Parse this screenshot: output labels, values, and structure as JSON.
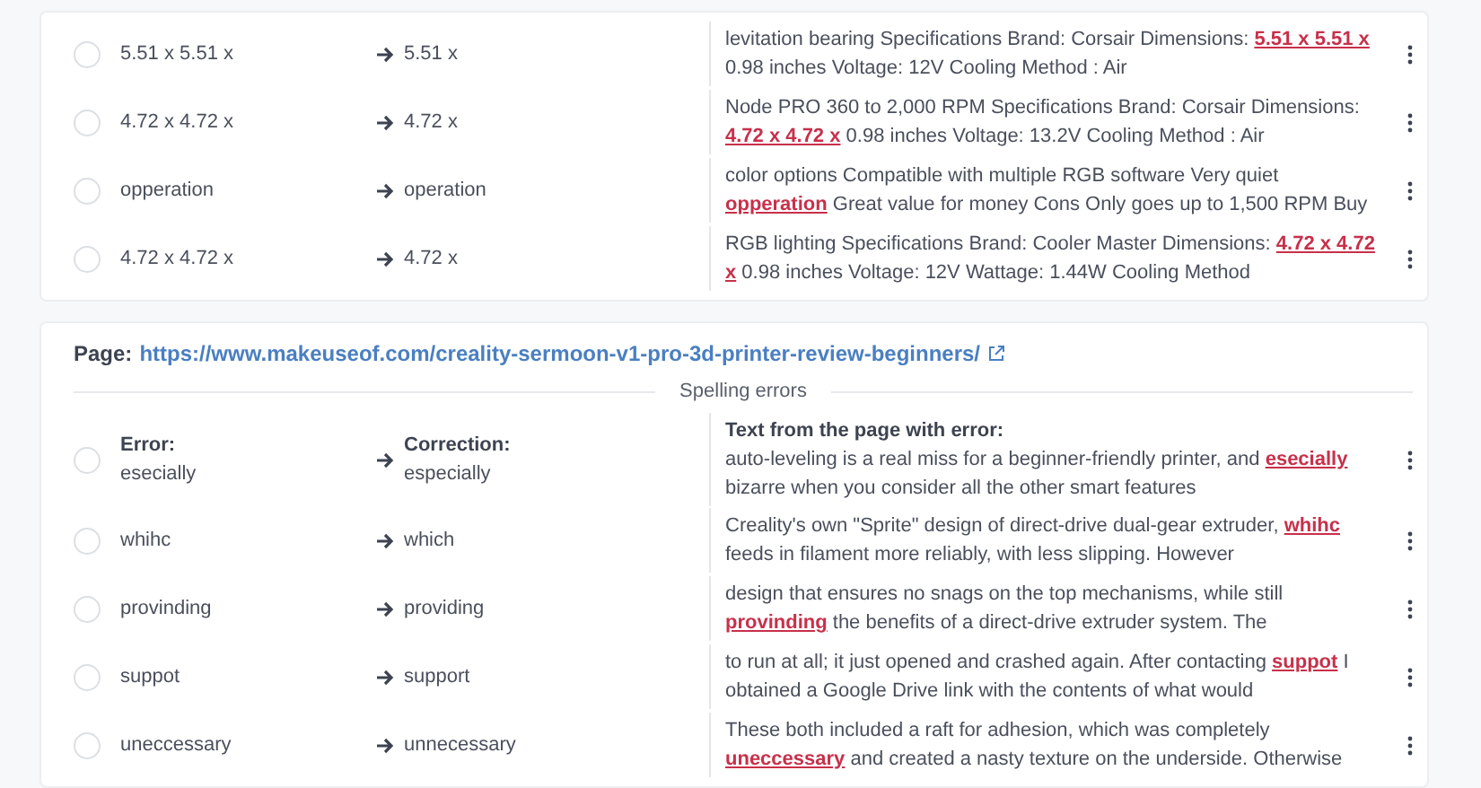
{
  "cards": [
    {
      "rows": [
        {
          "selected": false,
          "error": "5.51 x 5.51 x",
          "correction": "5.51 x",
          "context": "levitation bearing Specifications Brand: Corsair Dimensions: **5.51 x 5.51 x** 0.98 inches Voltage: 12V Cooling Method : Air"
        },
        {
          "selected": false,
          "error": "4.72 x 4.72 x",
          "correction": "4.72 x",
          "context": "Node PRO 360 to 2,000 RPM Specifications Brand: Corsair Dimensions: **4.72 x 4.72 x** 0.98 inches Voltage: 13.2V Cooling Method : Air"
        },
        {
          "selected": false,
          "error": "opperation",
          "correction": "operation",
          "context": "color options Compatible with multiple RGB software Very quiet **opperation** Great value for money Cons Only goes up to 1,500 RPM Buy"
        },
        {
          "selected": false,
          "error": "4.72 x 4.72 x",
          "correction": "4.72 x",
          "context": "RGB lighting Specifications Brand: Cooler Master Dimensions: **4.72 x 4.72 x** 0.98 inches Voltage: 12V Wattage: 1.44W Cooling Method"
        }
      ]
    },
    {
      "page_label": "Page:",
      "page_url": "https://www.makeuseof.com/creality-sermoon-v1-pro-3d-printer-review-beginners/",
      "section": "Spelling errors",
      "rows": [
        {
          "selected": false,
          "error_label": "Error:",
          "error": "esecially",
          "correction_label": "Correction:",
          "correction": "especially",
          "context_label": "Text from the page with error:",
          "context": "auto-leveling is a real miss for a beginner-friendly printer, and **esecially** bizarre when you consider all the other smart features"
        },
        {
          "selected": false,
          "error": "whihc",
          "correction": "which",
          "context": "Creality's own \"Sprite\" design of direct-drive dual-gear extruder, **whihc** feeds in filament more reliably, with less slipping. However"
        },
        {
          "selected": false,
          "error": "provinding",
          "correction": "providing",
          "context": "design that ensures no snags on the top mechanisms, while still **provinding** the benefits of a direct-drive extruder system. The"
        },
        {
          "selected": false,
          "error": "suppot",
          "correction": "support",
          "context": "to run at all; it just opened and crashed again. After contacting **suppot** I obtained a Google Drive link with the contents of what would"
        },
        {
          "selected": false,
          "error": "uneccessary",
          "correction": "unnecessary",
          "context": "These both included a raft for adhesion, which was completely **uneccessary** and created a nasty texture on the underside. Otherwise"
        }
      ]
    }
  ]
}
